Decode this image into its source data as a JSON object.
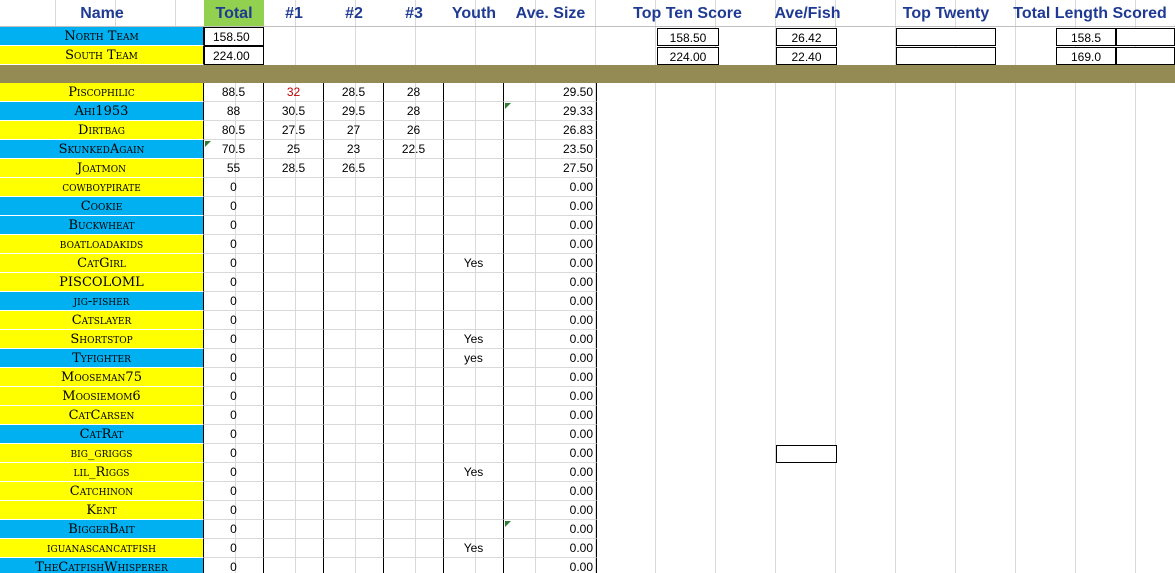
{
  "headers": {
    "name": "Name",
    "total": "Total",
    "c1": "#1",
    "c2": "#2",
    "c3": "#3",
    "youth": "Youth",
    "ave_size": "Ave. Size",
    "top_ten": "Top Ten Score",
    "ave_fish": "Ave/Fish",
    "top_twenty": "Top Twenty",
    "total_length": "Total Length Scored"
  },
  "teams": [
    {
      "name": "North Team",
      "total": "158.50",
      "top_ten": "158.50",
      "ave_fish": "26.42",
      "total_length": "158.5"
    },
    {
      "name": "South Team",
      "total": "224.00",
      "top_ten": "224.00",
      "ave_fish": "22.40",
      "total_length": "169.0"
    }
  ],
  "players": [
    {
      "name": "Piscophilic",
      "total": "88.5",
      "c1": "32",
      "c2": "28.5",
      "c3": "28",
      "youth": "",
      "ave": "29.50",
      "team": "yellow"
    },
    {
      "name": "Ahi1953",
      "total": "88",
      "c1": "30.5",
      "c2": "29.5",
      "c3": "28",
      "youth": "",
      "ave": "29.33",
      "team": "blue"
    },
    {
      "name": "Dirtbag",
      "total": "80.5",
      "c1": "27.5",
      "c2": "27",
      "c3": "26",
      "youth": "",
      "ave": "26.83",
      "team": "yellow"
    },
    {
      "name": "SkunkedAgain",
      "total": "70.5",
      "c1": "25",
      "c2": "23",
      "c3": "22.5",
      "youth": "",
      "ave": "23.50",
      "team": "blue"
    },
    {
      "name": "Joatmon",
      "total": "55",
      "c1": "28.5",
      "c2": "26.5",
      "c3": "",
      "youth": "",
      "ave": "27.50",
      "team": "yellow"
    },
    {
      "name": "cowboypirate",
      "total": "0",
      "c1": "",
      "c2": "",
      "c3": "",
      "youth": "",
      "ave": "0.00",
      "team": "yellow"
    },
    {
      "name": "Cookie",
      "total": "0",
      "c1": "",
      "c2": "",
      "c3": "",
      "youth": "",
      "ave": "0.00",
      "team": "blue"
    },
    {
      "name": "Buckwheat",
      "total": "0",
      "c1": "",
      "c2": "",
      "c3": "",
      "youth": "",
      "ave": "0.00",
      "team": "blue"
    },
    {
      "name": "boatloadakids",
      "total": "0",
      "c1": "",
      "c2": "",
      "c3": "",
      "youth": "",
      "ave": "0.00",
      "team": "yellow"
    },
    {
      "name": "CatGirl",
      "total": "0",
      "c1": "",
      "c2": "",
      "c3": "",
      "youth": "Yes",
      "ave": "0.00",
      "team": "yellow"
    },
    {
      "name": "PISCOLOML",
      "total": "0",
      "c1": "",
      "c2": "",
      "c3": "",
      "youth": "",
      "ave": "0.00",
      "team": "yellow"
    },
    {
      "name": "jig-fisher",
      "total": "0",
      "c1": "",
      "c2": "",
      "c3": "",
      "youth": "",
      "ave": "0.00",
      "team": "blue"
    },
    {
      "name": "Catslayer",
      "total": "0",
      "c1": "",
      "c2": "",
      "c3": "",
      "youth": "",
      "ave": "0.00",
      "team": "yellow"
    },
    {
      "name": "Shortstop",
      "total": "0",
      "c1": "",
      "c2": "",
      "c3": "",
      "youth": "Yes",
      "ave": "0.00",
      "team": "yellow"
    },
    {
      "name": "Tyfighter",
      "total": "0",
      "c1": "",
      "c2": "",
      "c3": "",
      "youth": "yes",
      "ave": "0.00",
      "team": "blue"
    },
    {
      "name": "Mooseman75",
      "total": "0",
      "c1": "",
      "c2": "",
      "c3": "",
      "youth": "",
      "ave": "0.00",
      "team": "yellow"
    },
    {
      "name": "Moosiemom6",
      "total": "0",
      "c1": "",
      "c2": "",
      "c3": "",
      "youth": "",
      "ave": "0.00",
      "team": "yellow"
    },
    {
      "name": "CatCarsen",
      "total": "0",
      "c1": "",
      "c2": "",
      "c3": "",
      "youth": "",
      "ave": "0.00",
      "team": "yellow"
    },
    {
      "name": "CatRat",
      "total": "0",
      "c1": "",
      "c2": "",
      "c3": "",
      "youth": "",
      "ave": "0.00",
      "team": "blue"
    },
    {
      "name": "big_griggs",
      "total": "0",
      "c1": "",
      "c2": "",
      "c3": "",
      "youth": "",
      "ave": "0.00",
      "team": "yellow"
    },
    {
      "name": "lil_Riggs",
      "total": "0",
      "c1": "",
      "c2": "",
      "c3": "",
      "youth": "Yes",
      "ave": "0.00",
      "team": "yellow"
    },
    {
      "name": "Catchinon",
      "total": "0",
      "c1": "",
      "c2": "",
      "c3": "",
      "youth": "",
      "ave": "0.00",
      "team": "yellow"
    },
    {
      "name": "Kent",
      "total": "0",
      "c1": "",
      "c2": "",
      "c3": "",
      "youth": "",
      "ave": "0.00",
      "team": "yellow"
    },
    {
      "name": "BiggerBait",
      "total": "0",
      "c1": "",
      "c2": "",
      "c3": "",
      "youth": "",
      "ave": "0.00",
      "team": "blue"
    },
    {
      "name": "iguanascancatfish",
      "total": "0",
      "c1": "",
      "c2": "",
      "c3": "",
      "youth": "Yes",
      "ave": "0.00",
      "team": "yellow"
    },
    {
      "name": "TheCatfishWhisperer",
      "total": "0",
      "c1": "",
      "c2": "",
      "c3": "",
      "youth": "",
      "ave": "0.00",
      "team": "blue"
    }
  ],
  "colors": {
    "yellow": "#ffff00",
    "blue": "#00b0f0",
    "total_header": "#92d050",
    "separator": "#948a54",
    "header_text": "#1f3a93",
    "red_value": "#c00000"
  }
}
